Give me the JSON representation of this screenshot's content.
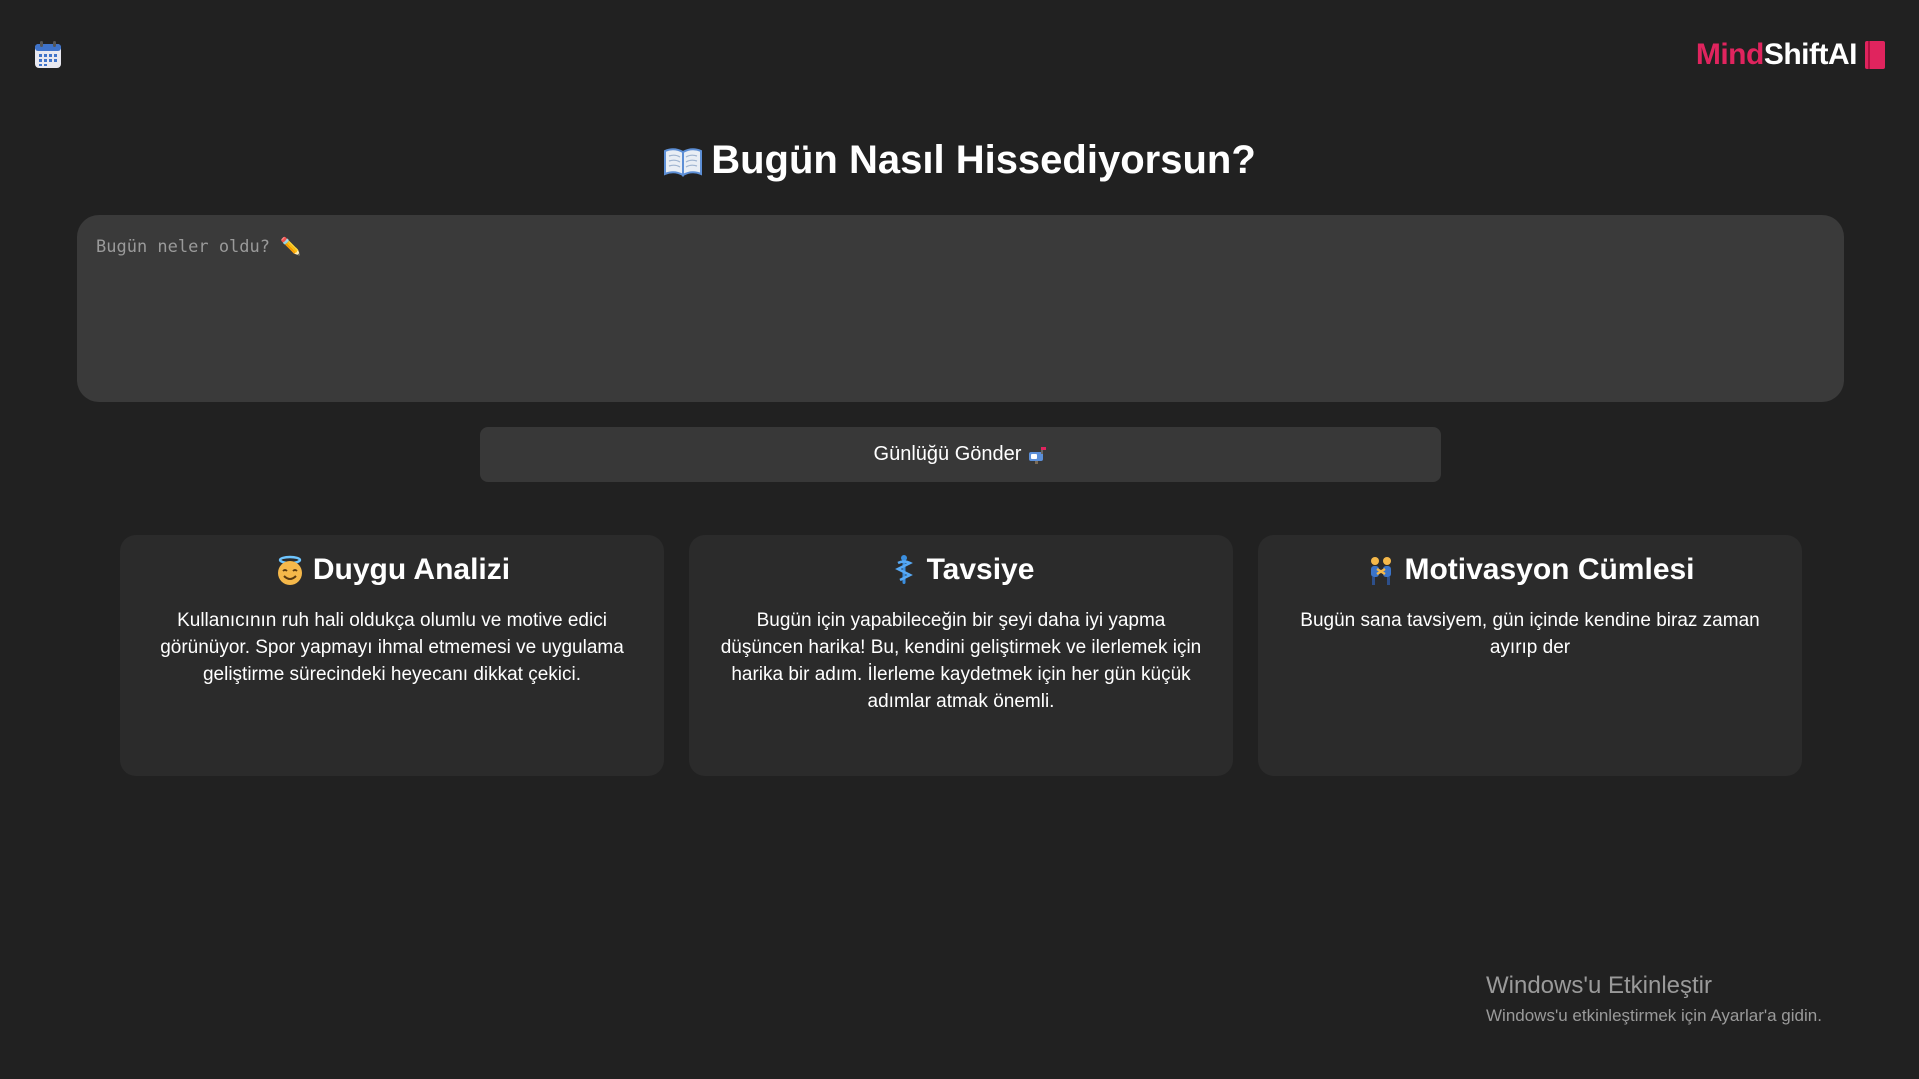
{
  "header": {
    "calendar_icon": "calendar-icon",
    "brand_part1": "Mind",
    "brand_part2": "ShiftAI",
    "brand_icon": "red-book-icon",
    "accent_color": "#e0245e"
  },
  "main": {
    "title": "Bugün Nasıl Hissediyorsun?",
    "title_icon": "open-book-icon",
    "entry_placeholder": "Bugün neler oldu? ✏️",
    "entry_value": "",
    "submit_label": "Günlüğü Gönder",
    "submit_icon": "mailbox-icon"
  },
  "cards": [
    {
      "title": "Duygu Analizi",
      "icon": "smiling-face-with-halo-icon",
      "text": "Kullanıcının ruh hali oldukça olumlu ve motive edici görünüyor. Spor yapmayı ihmal etmemesi ve uygulama geliştirme sürecindeki heyecanı dikkat çekici."
    },
    {
      "title": "Tavsiye",
      "icon": "medical-symbol-icon",
      "text": "Bugün için yapabileceğin bir şeyi daha iyi yapma düşüncen harika! Bu, kendini geliştirmek ve ilerlemek için harika bir adım. İlerleme kaydetmek için her gün küçük adımlar atmak önemli."
    },
    {
      "title": "Motivasyon Cümlesi",
      "icon": "people-wrestling-icon",
      "text": "Bugün sana tavsiyem, gün içinde kendine biraz zaman ayırıp der"
    }
  ],
  "watermark": {
    "title": "Windows'u Etkinleştir",
    "subtitle": "Windows'u etkinleştirmek için Ayarlar'a gidin."
  }
}
